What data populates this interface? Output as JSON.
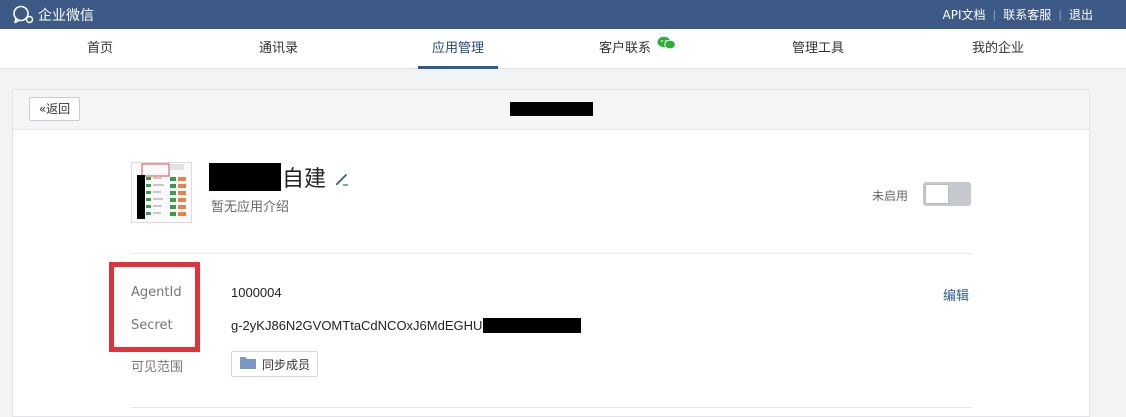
{
  "header": {
    "brand": "企业微信",
    "links": [
      "API文档",
      "联系客服",
      "退出"
    ]
  },
  "nav": {
    "items": [
      {
        "label": "首页"
      },
      {
        "label": "通讯录"
      },
      {
        "label": "应用管理",
        "active": true
      },
      {
        "label": "客户联系"
      },
      {
        "label": "管理工具"
      },
      {
        "label": "我的企业"
      }
    ]
  },
  "detail": {
    "back_label": "返回",
    "app": {
      "name_suffix": "自建",
      "description": "暂无应用介绍",
      "status_label": "未启用",
      "enabled": false
    },
    "fields": {
      "agentid_label": "AgentId",
      "agentid_value": "1000004",
      "secret_label": "Secret",
      "secret_value": "g-2yKJ86N2GVOMTtaCdNCOxJ6MdEGHU",
      "scope_label": "可见范围",
      "scope_button": "同步成员",
      "edit_label": "编辑"
    }
  },
  "colors": {
    "topbar": "#3d5a86",
    "accent": "#2f5b93",
    "highlight": "#e0323a"
  }
}
